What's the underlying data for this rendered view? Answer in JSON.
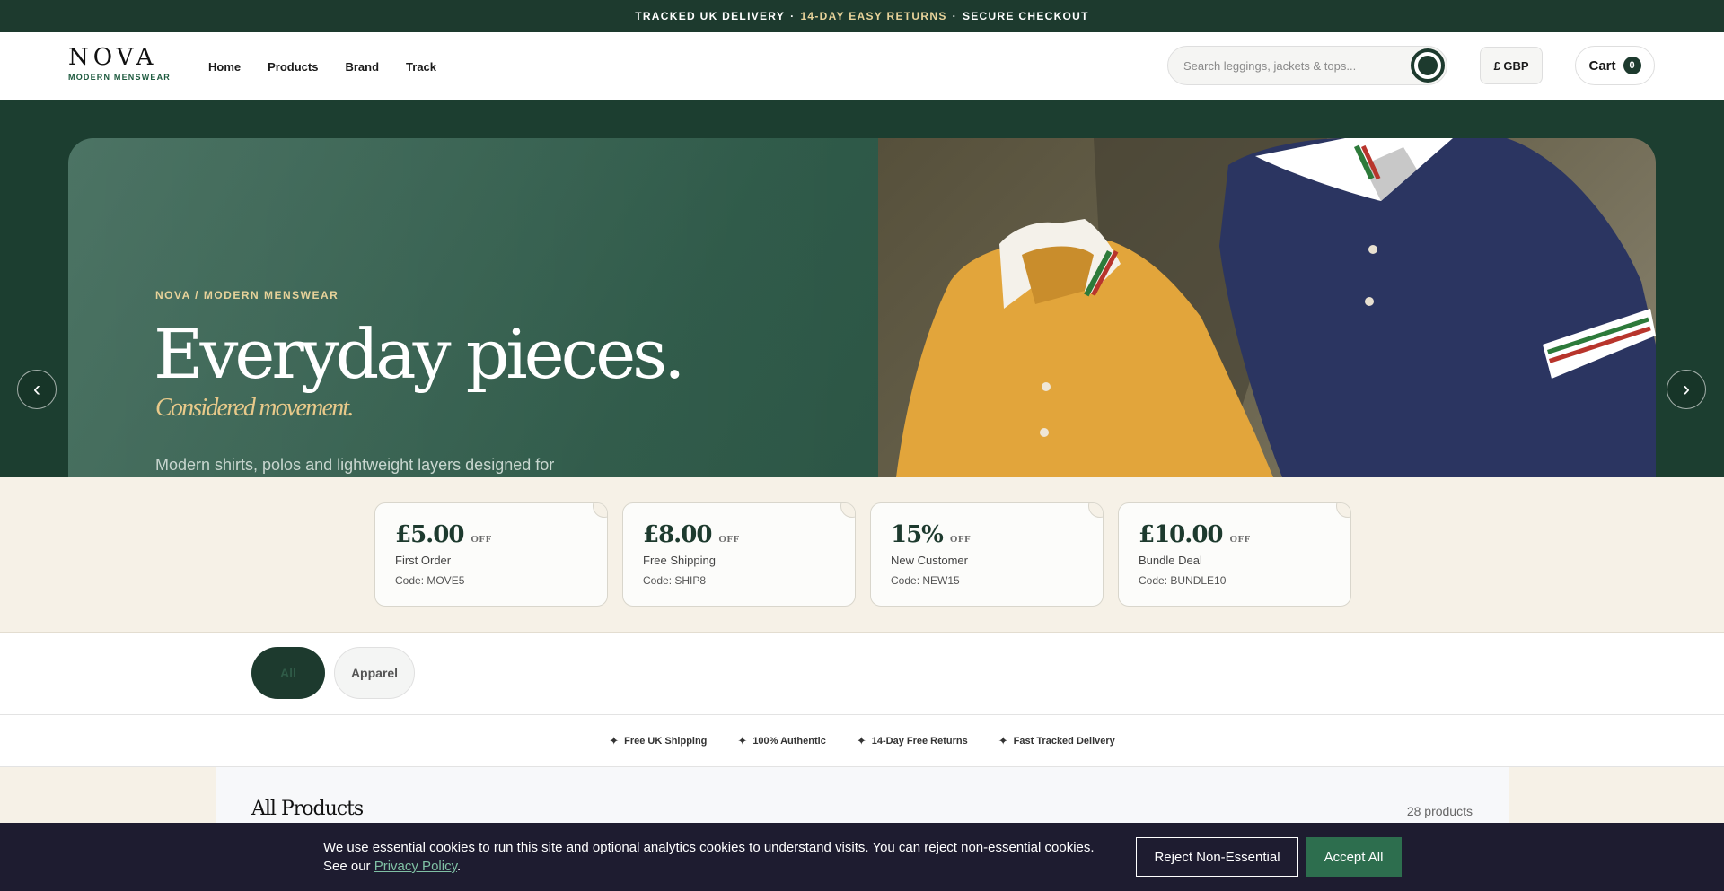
{
  "announcement": {
    "part1": "TRACKED UK DELIVERY",
    "sep": "·",
    "part2": "14-DAY EASY RETURNS",
    "part3": "SECURE CHECKOUT"
  },
  "header": {
    "logo": "NOVA",
    "logo_sub": "MODERN MENSWEAR",
    "nav": [
      "Home",
      "Products",
      "Brand",
      "Track"
    ],
    "search_placeholder": "Search leggings, jackets & tops...",
    "currency": "£ GBP",
    "cart_label": "Cart",
    "cart_count": "0"
  },
  "hero": {
    "kicker": "NOVA / MODERN MENSWEAR",
    "title": "Everyday pieces.",
    "subtitle": "Considered movement.",
    "description": "Modern shirts, polos and lightweight layers designed for",
    "prev": "‹",
    "next": "›"
  },
  "coupons": [
    {
      "value": "£5.00",
      "off": "OFF",
      "name": "First Order",
      "code": "Code: MOVE5"
    },
    {
      "value": "£8.00",
      "off": "OFF",
      "name": "Free Shipping",
      "code": "Code: SHIP8"
    },
    {
      "value": "15%",
      "off": "OFF",
      "name": "New Customer",
      "code": "Code: NEW15"
    },
    {
      "value": "£10.00",
      "off": "OFF",
      "name": "Bundle Deal",
      "code": "Code: BUNDLE10"
    }
  ],
  "filters": {
    "all": "All",
    "apparel": "Apparel"
  },
  "trust": [
    "Free UK Shipping",
    "100% Authentic",
    "14-Day Free Returns",
    "Fast Tracked Delivery"
  ],
  "products": {
    "title": "All Products",
    "count": "28 products"
  },
  "cookie": {
    "text_before": "We use essential cookies to run this site and optional analytics cookies to understand visits. You can reject non-essential cookies. See our ",
    "link": "Privacy Policy",
    "text_after": ".",
    "reject": "Reject Non-Essential",
    "accept": "Accept All"
  },
  "colors": {
    "brand_dark_green": "#1d3a2e",
    "accent_gold": "#e8d39a",
    "cream": "#f6f1e7",
    "cookie_bg": "#1e1c30",
    "accept_green": "#2d6e4e"
  }
}
